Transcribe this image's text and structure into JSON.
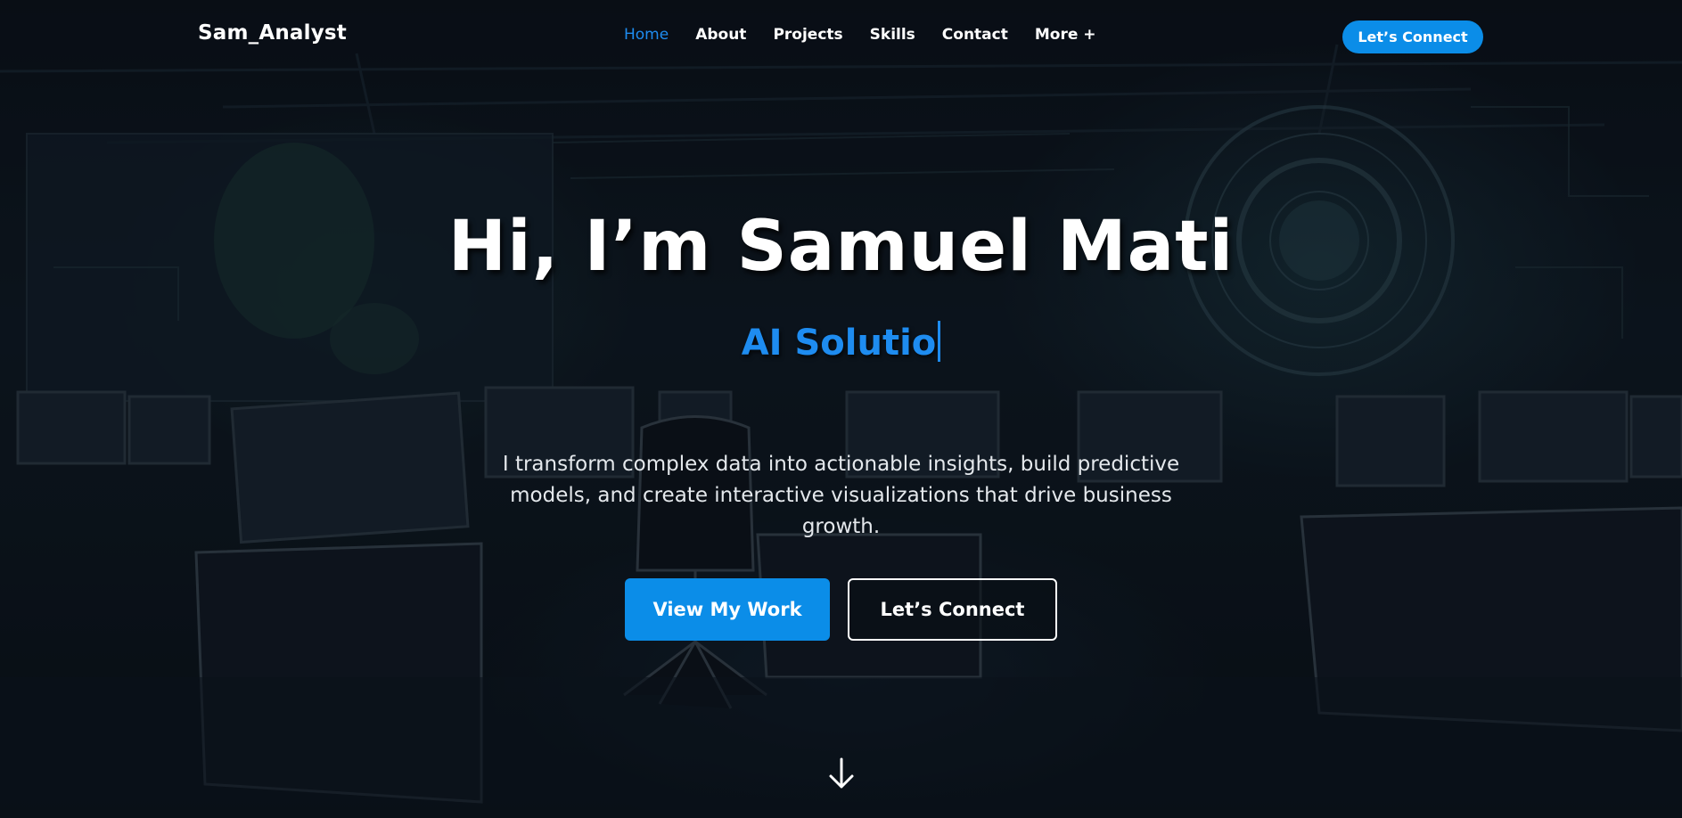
{
  "nav": {
    "brand": "Sam_Analyst",
    "links": [
      {
        "label": "Home",
        "active": true
      },
      {
        "label": "About"
      },
      {
        "label": "Projects"
      },
      {
        "label": "Skills"
      },
      {
        "label": "Contact"
      },
      {
        "label": "More +"
      }
    ],
    "cta_label": "Let’s Connect"
  },
  "hero": {
    "title": "Hi, I’m Samuel Mati",
    "typed_subtitle": "AI Solutio",
    "description": "I transform complex data into actionable insights, build predictive models, and create interactive visualizations that drive business growth.",
    "primary_button": "View My Work",
    "secondary_button": "Let’s Connect",
    "scroll_icon": "arrow-down-icon"
  },
  "colors": {
    "accent": "#1e8cf0",
    "button_blue": "#0b8de8",
    "background": "#0a0f16"
  }
}
